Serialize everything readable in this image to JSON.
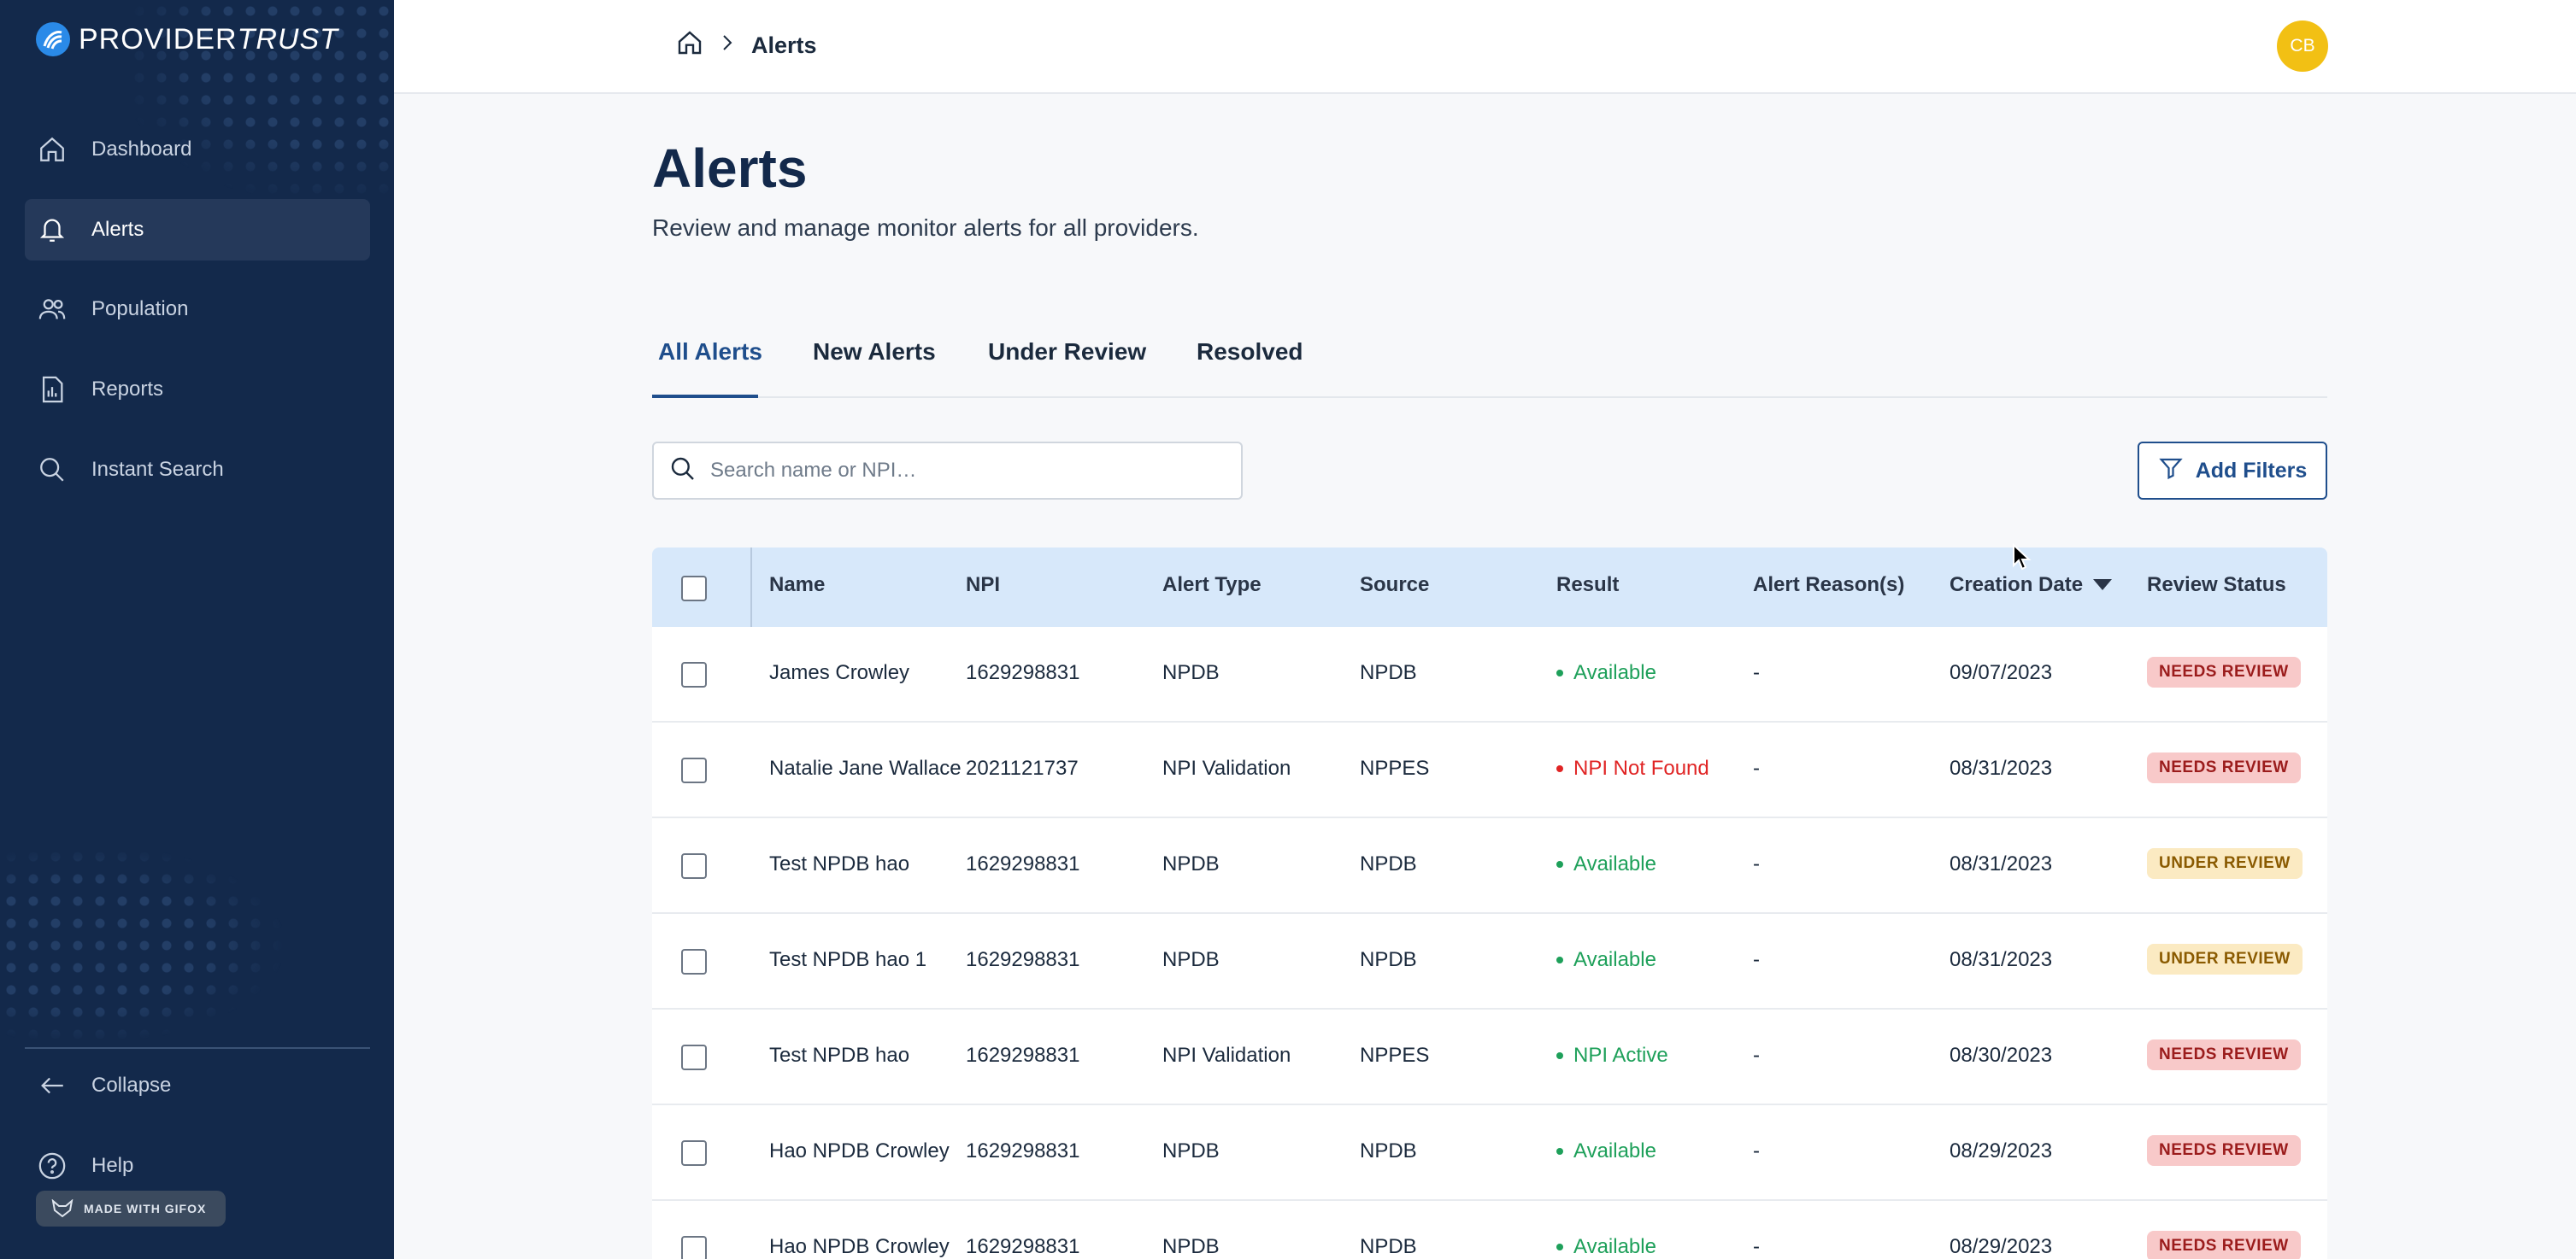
{
  "app": {
    "brand_part1": "PROVIDER",
    "brand_part2": "TRUST"
  },
  "sidebar": {
    "items": [
      {
        "label": "Dashboard",
        "icon": "home-icon"
      },
      {
        "label": "Alerts",
        "icon": "bell-icon",
        "active": true
      },
      {
        "label": "Population",
        "icon": "people-icon"
      },
      {
        "label": "Reports",
        "icon": "report-icon"
      },
      {
        "label": "Instant Search",
        "icon": "search-icon"
      }
    ],
    "collapse_label": "Collapse",
    "help_label": "Help",
    "gifox_label": "MADE WITH GIFOX"
  },
  "header": {
    "breadcrumb_current": "Alerts",
    "avatar_initials": "CB"
  },
  "page": {
    "title": "Alerts",
    "subtitle": "Review and manage monitor alerts for all providers."
  },
  "tabs": [
    {
      "label": "All Alerts",
      "active": true
    },
    {
      "label": "New Alerts"
    },
    {
      "label": "Under Review"
    },
    {
      "label": "Resolved"
    }
  ],
  "search": {
    "placeholder": "Search name or NPI…",
    "value": ""
  },
  "filters": {
    "label": "Add Filters"
  },
  "table": {
    "columns": [
      "Name",
      "NPI",
      "Alert Type",
      "Source",
      "Result",
      "Alert Reason(s)",
      "Creation Date",
      "Review Status"
    ],
    "sort_column": "Creation Date",
    "rows": [
      {
        "name": "James Crowley",
        "npi": "1629298831",
        "alert_type": "NPDB",
        "source": "NPDB",
        "result": "Available",
        "result_status": "ok",
        "reason": "-",
        "date": "09/07/2023",
        "status": "NEEDS REVIEW"
      },
      {
        "name": "Natalie Jane Wallace",
        "npi": "2021121737",
        "alert_type": "NPI Validation",
        "source": "NPPES",
        "result": "NPI Not Found",
        "result_status": "error",
        "reason": "-",
        "date": "08/31/2023",
        "status": "NEEDS REVIEW"
      },
      {
        "name": "Test NPDB hao",
        "npi": "1629298831",
        "alert_type": "NPDB",
        "source": "NPDB",
        "result": "Available",
        "result_status": "ok",
        "reason": "-",
        "date": "08/31/2023",
        "status": "UNDER REVIEW"
      },
      {
        "name": "Test NPDB hao 1",
        "npi": "1629298831",
        "alert_type": "NPDB",
        "source": "NPDB",
        "result": "Available",
        "result_status": "ok",
        "reason": "-",
        "date": "08/31/2023",
        "status": "UNDER REVIEW"
      },
      {
        "name": "Test NPDB hao",
        "npi": "1629298831",
        "alert_type": "NPI Validation",
        "source": "NPPES",
        "result": "NPI Active",
        "result_status": "ok",
        "reason": "-",
        "date": "08/30/2023",
        "status": "NEEDS REVIEW"
      },
      {
        "name": "Hao NPDB Crowley",
        "npi": "1629298831",
        "alert_type": "NPDB",
        "source": "NPDB",
        "result": "Available",
        "result_status": "ok",
        "reason": "-",
        "date": "08/29/2023",
        "status": "NEEDS REVIEW"
      },
      {
        "name": "Hao NPDB Crowley",
        "npi": "1629298831",
        "alert_type": "NPDB",
        "source": "NPDB",
        "result": "Available",
        "result_status": "ok",
        "reason": "-",
        "date": "08/29/2023",
        "status": "NEEDS REVIEW"
      }
    ]
  },
  "colors": {
    "sidebar_bg": "#13294b",
    "accent": "#1f4e8c",
    "ok": "#1ea05a",
    "error": "#e02424",
    "needs_review_bg": "#f8c9c9",
    "needs_review_fg": "#9b1c1c",
    "under_review_bg": "#fbeac2",
    "under_review_fg": "#8a5a00"
  }
}
